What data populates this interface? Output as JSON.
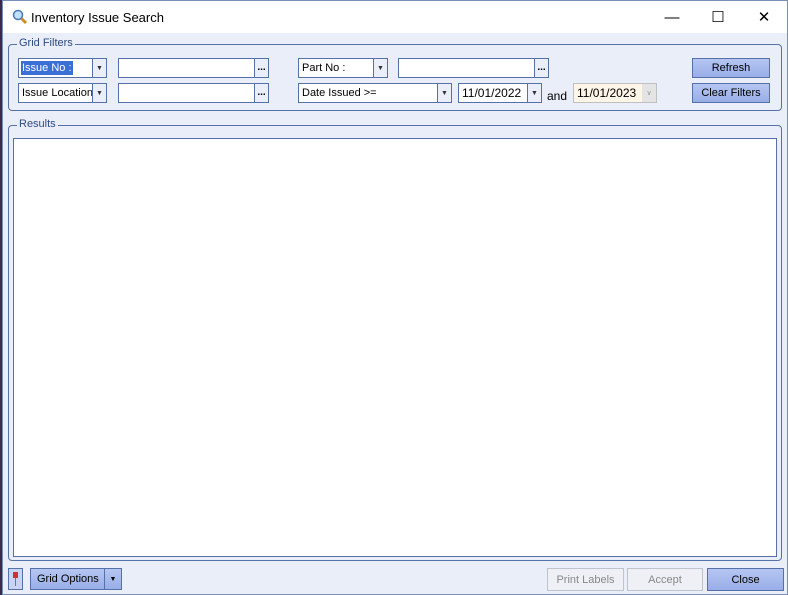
{
  "window": {
    "title": "Inventory Issue Search",
    "minimize": "—",
    "maximize": "☐",
    "close": "✕"
  },
  "filters": {
    "group_label": "Grid Filters",
    "field1": "Issue No :",
    "field2": "Issue Location",
    "field3": "Part No :",
    "field4": "Date Issued >=",
    "value1": "",
    "value2": "",
    "value3": "",
    "date_from": "11/01/2022",
    "and_label": "and",
    "date_to": "11/01/2023",
    "refresh": "Refresh",
    "clear": "Clear Filters",
    "ellipsis": "..."
  },
  "results": {
    "group_label": "Results",
    "rows": []
  },
  "footer": {
    "grid_options": "Grid Options",
    "print_labels": "Print Labels",
    "accept": "Accept",
    "close": "Close"
  }
}
